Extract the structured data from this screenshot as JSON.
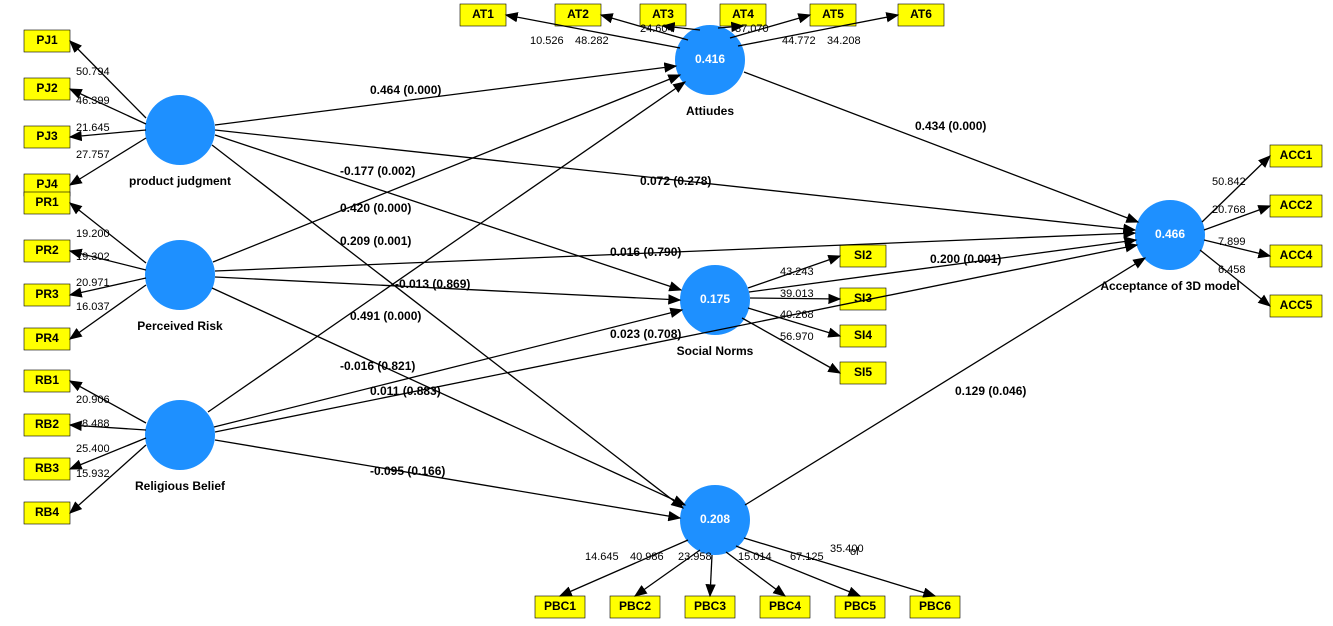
{
  "constructs": {
    "PJ": {
      "label": "product judgment",
      "r2": ""
    },
    "PR": {
      "label": "Perceived Risk",
      "r2": ""
    },
    "RB": {
      "label": "Religious Belief",
      "r2": ""
    },
    "AT": {
      "label": "Attiudes",
      "r2": "0.416"
    },
    "SN": {
      "label": "Social Norms",
      "r2": "0.175"
    },
    "PBC": {
      "label": "",
      "r2": "0.208"
    },
    "ACC": {
      "label": "Acceptance of 3D model",
      "r2": "0.466"
    }
  },
  "pbc_label_partial": "ol",
  "indicators": {
    "PJ": [
      {
        "n": "PJ1",
        "l": "50.794"
      },
      {
        "n": "PJ2",
        "l": "46.399"
      },
      {
        "n": "PJ3",
        "l": "21.645"
      },
      {
        "n": "PJ4",
        "l": "27.757"
      }
    ],
    "PR": [
      {
        "n": "PR1",
        "l": "19.200"
      },
      {
        "n": "PR2",
        "l": "19.302"
      },
      {
        "n": "PR3",
        "l": "20.971"
      },
      {
        "n": "PR4",
        "l": "16.037"
      }
    ],
    "RB": [
      {
        "n": "RB1",
        "l": "20.906"
      },
      {
        "n": "RB2",
        "l": "8.488"
      },
      {
        "n": "RB3",
        "l": "25.400"
      },
      {
        "n": "RB4",
        "l": "15.932"
      }
    ],
    "AT": [
      {
        "n": "AT1",
        "l": "10.526"
      },
      {
        "n": "AT2",
        "l": "48.282"
      },
      {
        "n": "AT3",
        "l": "24.604"
      },
      {
        "n": "AT4",
        "l": "37.070"
      },
      {
        "n": "AT5",
        "l": "44.772"
      },
      {
        "n": "AT6",
        "l": "34.208"
      }
    ],
    "SN": [
      {
        "n": "SI2",
        "l": "43.243"
      },
      {
        "n": "SI3",
        "l": "39.013"
      },
      {
        "n": "SI4",
        "l": "40.268"
      },
      {
        "n": "SI5",
        "l": "56.970"
      }
    ],
    "PBC": [
      {
        "n": "PBC1",
        "l": "14.645"
      },
      {
        "n": "PBC2",
        "l": "40.986"
      },
      {
        "n": "PBC3",
        "l": "23.958"
      },
      {
        "n": "PBC4",
        "l": "15.014"
      },
      {
        "n": "PBC5",
        "l": "67.125"
      },
      {
        "n": "PBC6",
        "l": "35.400"
      }
    ],
    "ACC": [
      {
        "n": "ACC1",
        "l": "50.842"
      },
      {
        "n": "ACC2",
        "l": "20.768"
      },
      {
        "n": "ACC4",
        "l": "7.899"
      },
      {
        "n": "ACC5",
        "l": "6.458"
      }
    ]
  },
  "paths": {
    "PJ_AT": "0.464 (0.000)",
    "PJ_SN": "-0.177 (0.002)",
    "PJ_PBC": "0.209 (0.001)",
    "PJ_ACC": "0.072 (0.278)",
    "PR_AT": "0.420 (0.000)",
    "PR_SN": "-0.013 (0.869)",
    "PR_PBC": "0.491 (0.000)",
    "PR_ACC": "0.016 (0.790)",
    "RB_AT": "-0.016 (0.821)",
    "RB_SN": "0.011 (0.883)",
    "RB_PBC": "-0.095 (0.166)",
    "RB_ACC": "0.023 (0.708)",
    "AT_ACC": "0.434 (0.000)",
    "SN_ACC": "0.200 (0.001)",
    "PBC_ACC": "0.129 (0.046)"
  }
}
